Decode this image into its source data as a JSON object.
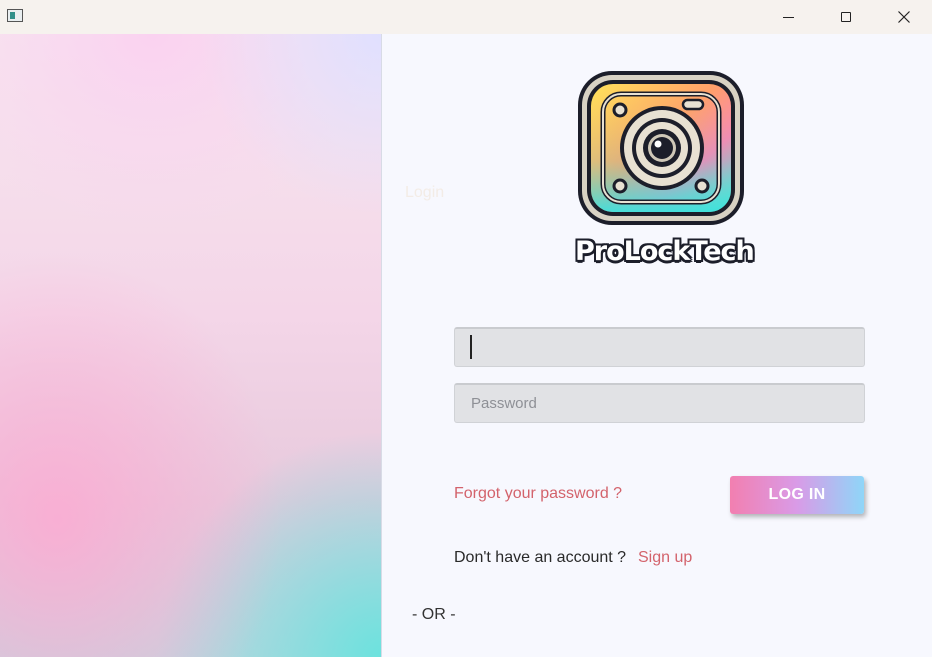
{
  "window": {
    "controls": {
      "minimize_icon": "minimize-icon",
      "maximize_icon": "maximize-icon",
      "close_icon": "close-icon",
      "close_glyph": "✕"
    }
  },
  "background_label": "Login",
  "logo": {
    "brand_name": "ProLockTech",
    "icon": "camera-icon"
  },
  "form": {
    "username": {
      "value": "",
      "placeholder": ""
    },
    "password": {
      "value": "",
      "placeholder": "Password"
    },
    "forgot_password_link": "Forgot your password ?",
    "login_button": "LOG IN",
    "no_account_text": "Don't have an account ?",
    "signup_link": "Sign up",
    "or_divider": "- OR -"
  },
  "colors": {
    "link": "#d3636c",
    "button_gradient": [
      "#f27fb0",
      "#d99be7",
      "#8fd6f8"
    ],
    "field_bg": "#e1e2e5"
  }
}
